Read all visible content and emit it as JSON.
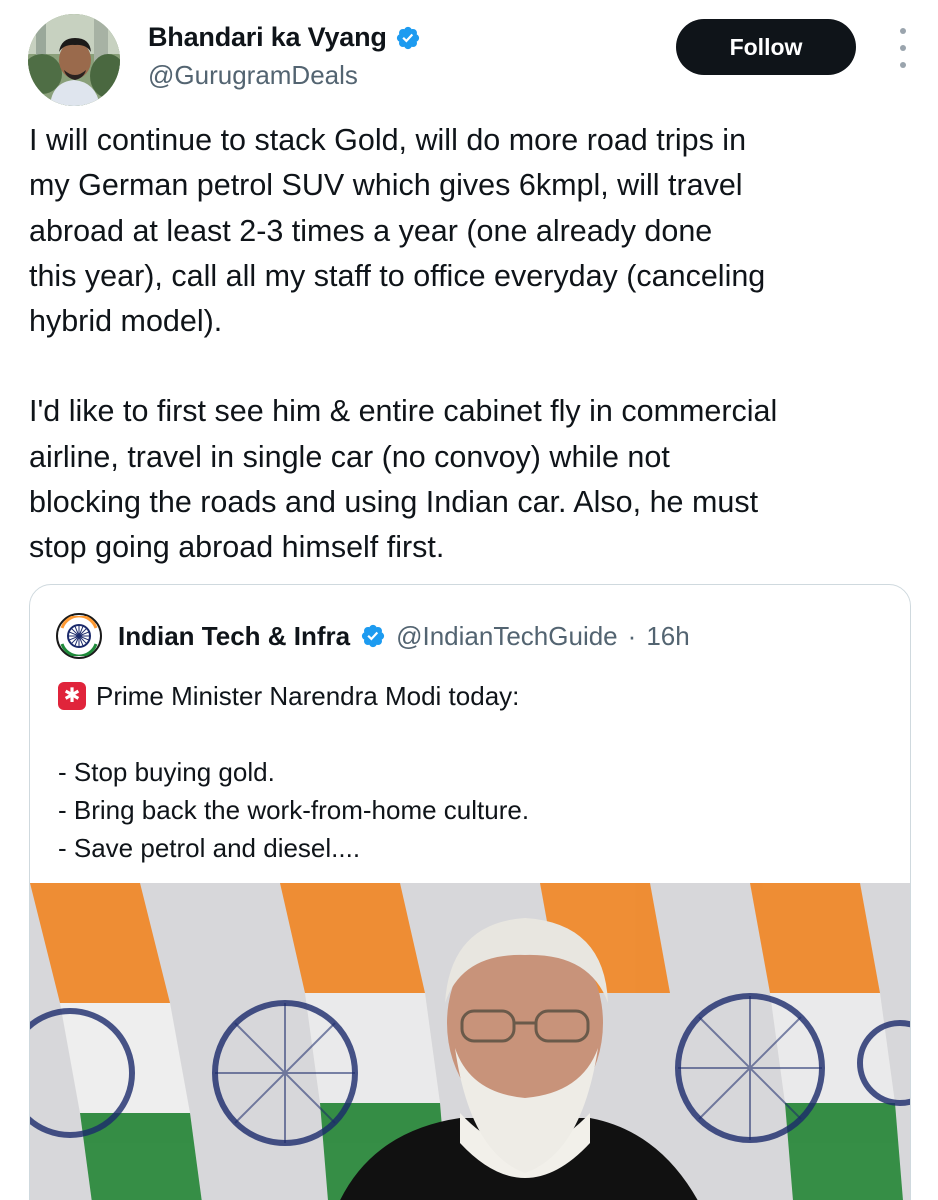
{
  "author": {
    "display_name": "Bhandari ka Vyang",
    "handle": "@GurugramDeals",
    "verified": true
  },
  "follow_label": "Follow",
  "icons": {
    "verified": "verified-badge-icon",
    "more": "more-vertical-icon",
    "siren": "rotating-light-icon"
  },
  "tweet": {
    "paragraphs": [
      "I will continue to stack Gold, will do more road trips in my German petrol SUV which gives 6kmpl, will travel abroad at least 2-3 times a year (one already done this year), call all my staff to office everyday (canceling hybrid model).",
      "I'd like to first see him & entire cabinet fly in commercial airline, travel in single car (no convoy) while not blocking the roads and using Indian car. Also, he must stop going abroad himself first."
    ],
    "lines_p1": [
      "I will continue to stack Gold, will do more road trips in",
      "my German petrol SUV which gives 6kmpl, will travel",
      "abroad at least 2-3 times a year (one already done",
      "this year), call all my staff to office everyday (canceling",
      "hybrid model)."
    ],
    "lines_p2": [
      "I'd like to first see him & entire cabinet fly in commercial",
      "airline, travel in single car (no convoy) while not",
      "blocking the roads and using Indian car. Also, he must",
      "stop going abroad himself first."
    ]
  },
  "quote": {
    "display_name": "Indian Tech & Infra",
    "handle": "@IndianTechGuide",
    "separator": "·",
    "time": "16h",
    "headline": "Prime Minister Narendra Modi today:",
    "items": [
      "- Stop buying gold.",
      "- Bring back the work-from-home culture.",
      "- Save petrol and diesel...."
    ]
  },
  "colors": {
    "text": "#0f1419",
    "secondary": "#536471",
    "verified_blue": "#1d9bf0",
    "follow_bg": "#0f1419",
    "border": "#cfd9de",
    "saffron": "#ff8a1e",
    "green": "#1f8a3a",
    "chakra": "#1b2a6b"
  }
}
